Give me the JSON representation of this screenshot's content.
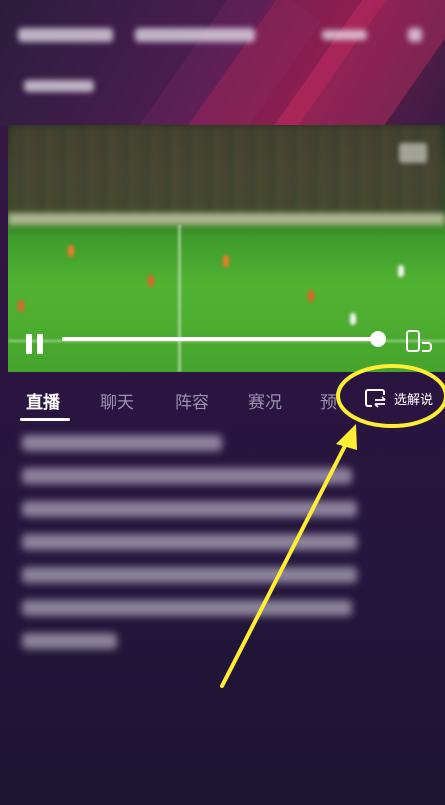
{
  "tabs": {
    "items": [
      {
        "label": "直播",
        "active": true
      },
      {
        "label": "聊天",
        "active": false
      },
      {
        "label": "阵容",
        "active": false
      },
      {
        "label": "赛况",
        "active": false
      },
      {
        "label": "预",
        "active": false
      }
    ],
    "commentary_label": "选解说"
  },
  "player": {
    "progress": 1.0
  },
  "colors": {
    "annotation": "#ffee33",
    "accent": "#ffffff",
    "tab_inactive": "#9b93ad"
  }
}
